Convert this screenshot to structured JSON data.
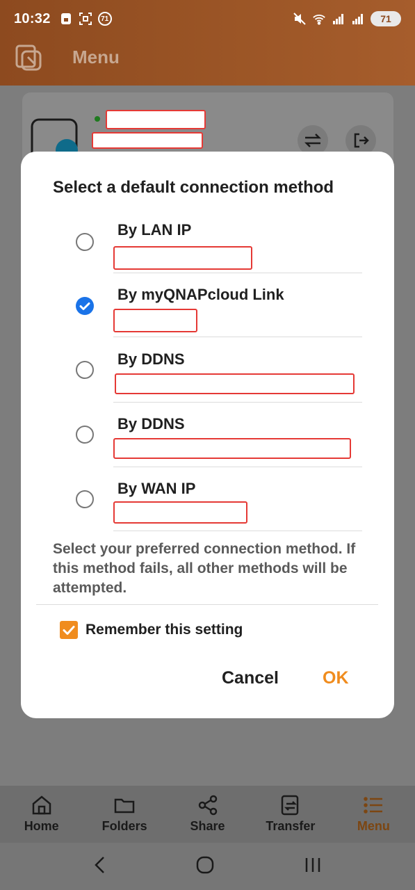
{
  "status_bar": {
    "time": "10:32",
    "notification_badge": "71",
    "battery": "71"
  },
  "header": {
    "title": "Menu"
  },
  "dialog": {
    "title": "Select a default connection method",
    "options": [
      {
        "label": "By LAN IP",
        "selected": false
      },
      {
        "label": "By myQNAPcloud Link",
        "selected": true
      },
      {
        "label": "By DDNS",
        "selected": false
      },
      {
        "label": "By DDNS",
        "selected": false
      },
      {
        "label": "By WAN IP",
        "selected": false
      }
    ],
    "hint": "Select your preferred connection method. If this method fails, all other methods will be attempted.",
    "remember_label": "Remember this setting",
    "remember_checked": true,
    "cancel_label": "Cancel",
    "ok_label": "OK"
  },
  "bottom_nav": {
    "items": [
      {
        "label": "Home",
        "icon": "home-icon"
      },
      {
        "label": "Folders",
        "icon": "folder-icon"
      },
      {
        "label": "Share",
        "icon": "share-icon"
      },
      {
        "label": "Transfer",
        "icon": "transfer-icon"
      },
      {
        "label": "Menu",
        "icon": "menu-icon",
        "active": true
      }
    ]
  },
  "colors": {
    "accent": "#f08c1e",
    "radio_selected": "#1a73e8",
    "redaction": "#e53935"
  }
}
